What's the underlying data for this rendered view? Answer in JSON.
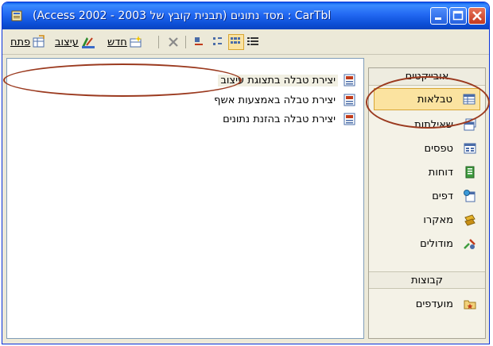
{
  "window": {
    "title": "(Access 2002 - 2003 תבנית קובץ של) מסד נתונים : CarTbl"
  },
  "toolbar": {
    "open_label": "פתח",
    "design_label": "עיצוב",
    "new_label": "חדש"
  },
  "list": {
    "items": [
      {
        "label": "יצירת טבלה בתצוגת עיצוב",
        "selected": true
      },
      {
        "label": "יצירת טבלה באמצעות אשף",
        "selected": false
      },
      {
        "label": "יצירת טבלה בהזנת נתונים",
        "selected": false
      }
    ]
  },
  "objects": {
    "header": "אובייקטים",
    "items": [
      {
        "label": "טבלאות",
        "icon": "table-icon",
        "active": true
      },
      {
        "label": "שאילתות",
        "icon": "query-icon",
        "active": false
      },
      {
        "label": "טפסים",
        "icon": "form-icon",
        "active": false
      },
      {
        "label": "דוחות",
        "icon": "report-icon",
        "active": false
      },
      {
        "label": "דפים",
        "icon": "page-icon",
        "active": false
      },
      {
        "label": "מאקרו",
        "icon": "macro-icon",
        "active": false
      },
      {
        "label": "מודולים",
        "icon": "module-icon",
        "active": false
      }
    ]
  },
  "groups": {
    "header": "קבוצות",
    "favorites_label": "מועדפים"
  },
  "colors": {
    "titlebar": "#2268f2",
    "active_object": "#fbe3a0",
    "annotation": "#9b3a1f"
  }
}
